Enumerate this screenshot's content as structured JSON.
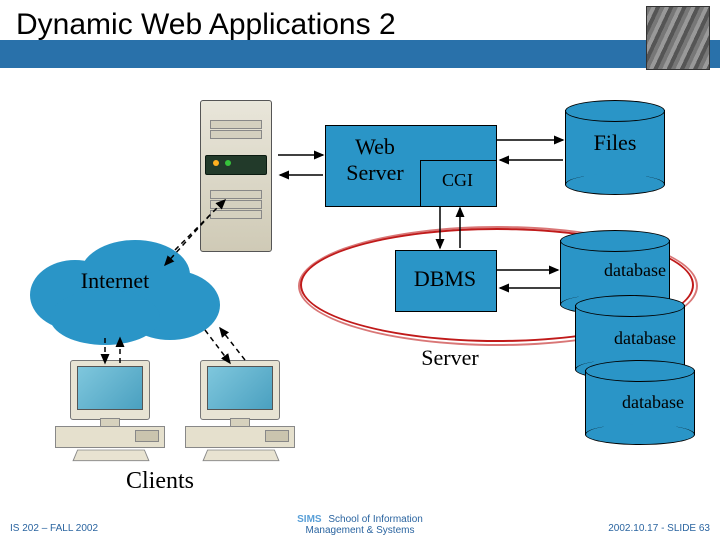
{
  "title": "Dynamic Web Applications 2",
  "labels": {
    "web_server": "Web\nServer",
    "cgi": "CGI",
    "files": "Files",
    "internet": "Internet",
    "dbms": "DBMS",
    "server": "Server",
    "database1": "database",
    "database2": "database",
    "database3": "database",
    "clients": "Clients"
  },
  "footer": {
    "left": "IS 202 – FALL 2002",
    "center_prefix": "SIMS",
    "center_line1": "School of Information",
    "center_line2": "Management & Systems",
    "right": "2002.10.17 - SLIDE 63"
  },
  "colors": {
    "accent": "#2a95c7",
    "bar": "#2971aa",
    "ring": "#c01a1a"
  }
}
